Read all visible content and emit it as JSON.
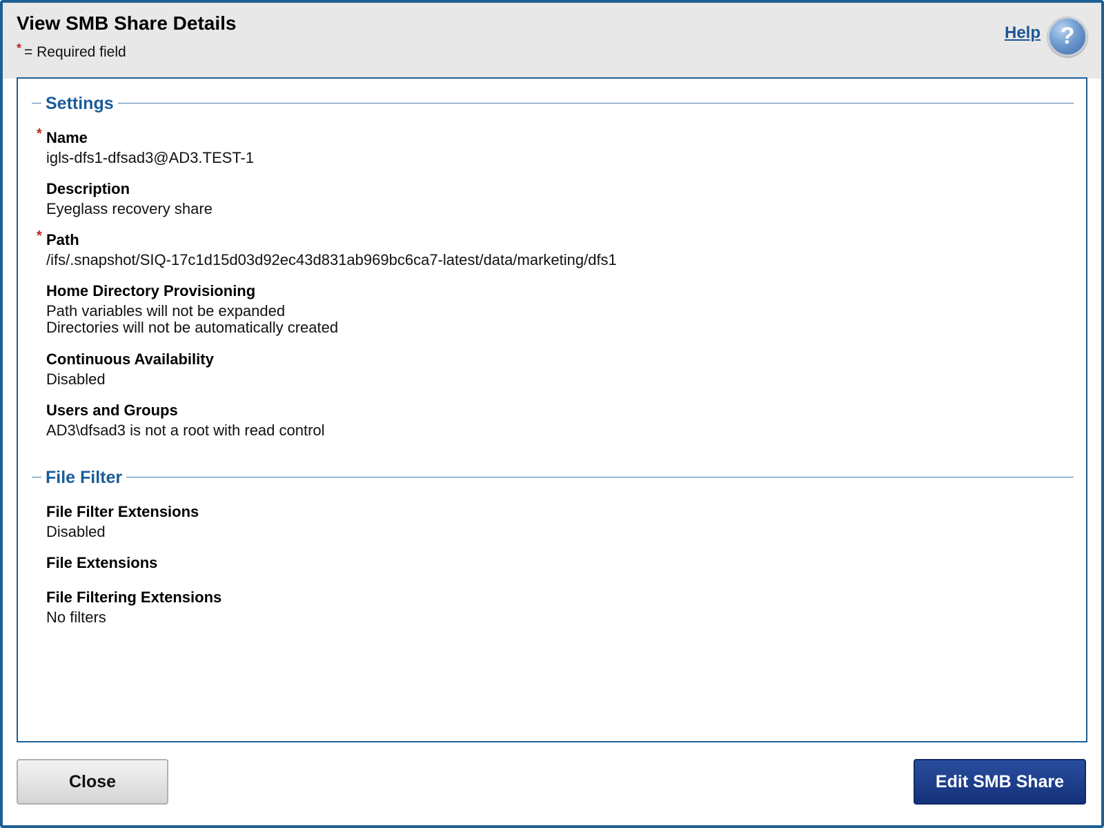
{
  "dialog": {
    "title": "View SMB Share Details",
    "required_marker": "*",
    "required_note": "= Required field",
    "help_label": "Help",
    "help_icon": "question-mark-icon"
  },
  "settings": {
    "legend": "Settings",
    "name": {
      "label": "Name",
      "value": "igls-dfs1-dfsad3@AD3.TEST-1",
      "required": true
    },
    "description": {
      "label": "Description",
      "value": "Eyeglass recovery share"
    },
    "path": {
      "label": "Path",
      "value": "/ifs/.snapshot/SIQ-17c1d15d03d92ec43d831ab969bc6ca7-latest/data/marketing/dfs1",
      "required": true
    },
    "home_dir": {
      "label": "Home Directory Provisioning",
      "line1": "Path variables will not be expanded",
      "line2": "Directories will not be automatically created"
    },
    "continuous": {
      "label": "Continuous Availability",
      "value": "Disabled"
    },
    "users": {
      "label": "Users and Groups",
      "value": "AD3\\dfsad3 is not a root with read control"
    }
  },
  "file_filter": {
    "legend": "File Filter",
    "extensions_enabled": {
      "label": "File Filter Extensions",
      "value": "Disabled"
    },
    "extensions": {
      "label": "File Extensions",
      "value": ""
    },
    "filtering": {
      "label": "File Filtering Extensions",
      "value": "No filters"
    }
  },
  "footer": {
    "close_label": "Close",
    "edit_label": "Edit SMB Share"
  },
  "colors": {
    "accent": "#1f5f93",
    "legend_text": "#1a5c99",
    "required": "#c0281c",
    "primary_button": "#1b3a86"
  }
}
